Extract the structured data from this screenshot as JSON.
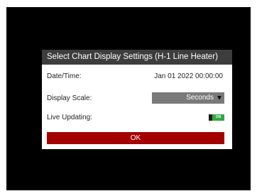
{
  "dialog": {
    "title": "Select Chart Display Settings (H-1 Line Heater)",
    "date_time": {
      "label": "Date/Time:",
      "value": "Jan 01 2022 00:00:00"
    },
    "display_scale": {
      "label": "Display Scale:",
      "selected": "Seconds"
    },
    "live_updating": {
      "label": "Live Updating:",
      "state": "ON"
    },
    "ok_label": "OK"
  },
  "colors": {
    "background": "#000000",
    "title_bar": "#3d3d3d",
    "ok_button": "#a40000",
    "toggle_on": "#2eaa3f",
    "select_bg": "#7a7a7a"
  },
  "icons": {
    "dropdown": "chevron-down-icon"
  }
}
